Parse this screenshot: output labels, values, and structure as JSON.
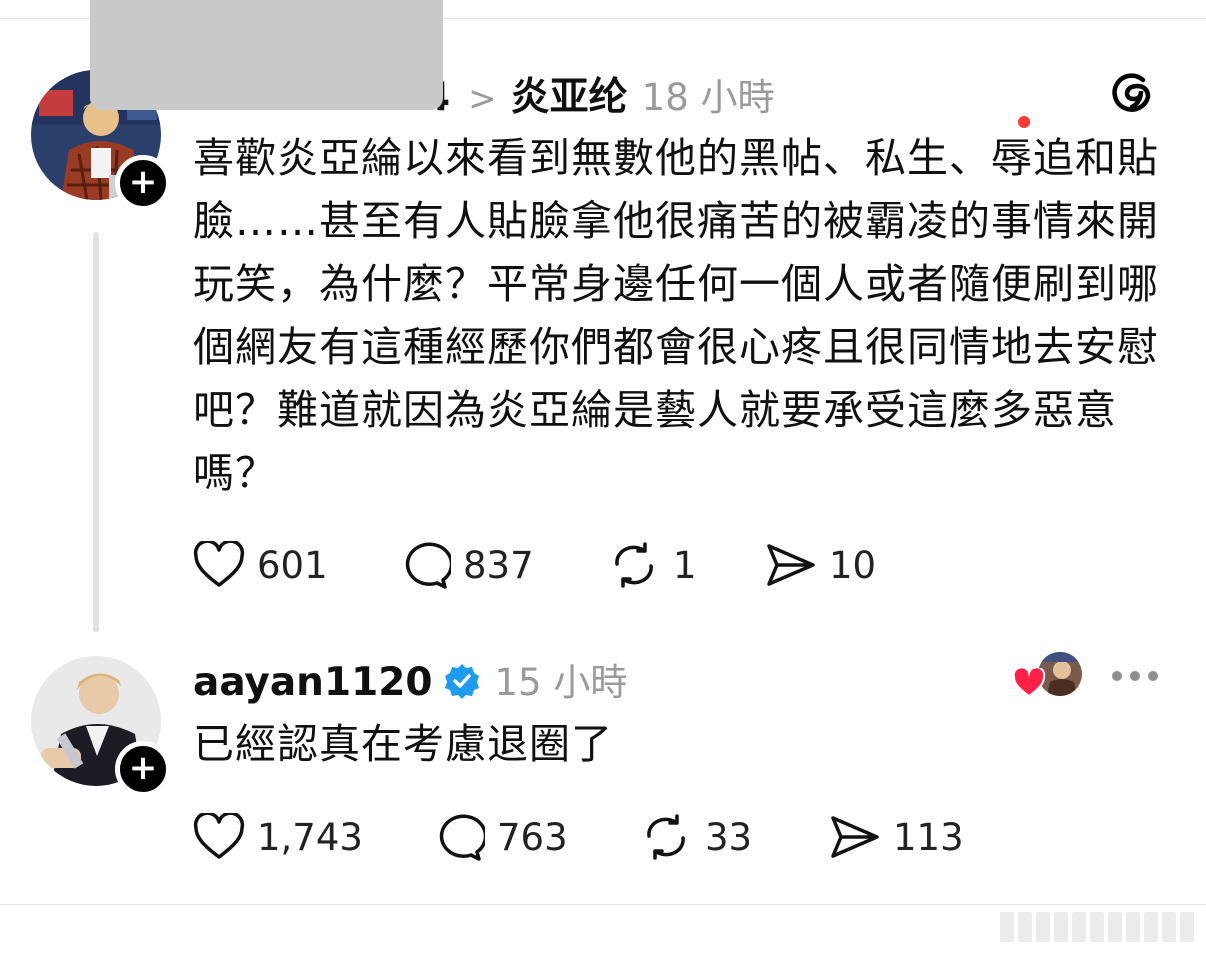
{
  "post1": {
    "username_suffix": "4",
    "chevron": ">",
    "reply_to": "炎亚纶",
    "time": "18 小時",
    "body": "喜歡炎亞綸以來看到無數他的黑帖、私生、辱追和貼臉……甚至有人貼臉拿他很痛苦的被霸凌的事情來開玩笑，為什麼？平常身邊任何一個人或者隨便刷到哪個網友有這種經歷你們都會很心疼且很同情地去安慰吧？難道就因為炎亞綸是藝人就要承受這麼多惡意嗎？",
    "likes": "601",
    "comments": "837",
    "reposts": "1",
    "shares": "10"
  },
  "post2": {
    "username": "aayan1120",
    "time": "15 小時",
    "body": "已經認真在考慮退圈了",
    "likes": "1,743",
    "comments": "763",
    "reposts": "33",
    "shares": "113"
  },
  "icons": {
    "app_logo": "threads-logo-icon",
    "follow": "plus-icon",
    "like": "heart-icon",
    "comment": "comment-bubble-icon",
    "repost": "repost-arrows-icon",
    "share": "paper-plane-icon",
    "verified": "verified-badge-icon",
    "more": "more-dots-icon"
  },
  "colors": {
    "verified": "#1d9bf0",
    "liked_heart": "#ff1f47",
    "secondary_text": "#9a9a9a",
    "notification_dot": "#ff3a2e"
  }
}
